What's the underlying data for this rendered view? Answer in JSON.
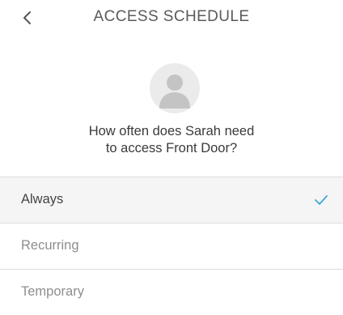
{
  "header": {
    "title": "ACCESS SCHEDULE",
    "back_icon": "chevron-left-icon"
  },
  "avatar": {
    "icon": "user-silhouette-icon"
  },
  "question": {
    "line1": "How often does Sarah need",
    "line2": "to access Front Door?"
  },
  "options": [
    {
      "label": "Always",
      "selected": true
    },
    {
      "label": "Recurring",
      "selected": false
    },
    {
      "label": "Temporary",
      "selected": false
    }
  ],
  "colors": {
    "accent": "#3fa7d6",
    "selected_background": "#f5f5f5",
    "divider": "#dcdcdc"
  }
}
